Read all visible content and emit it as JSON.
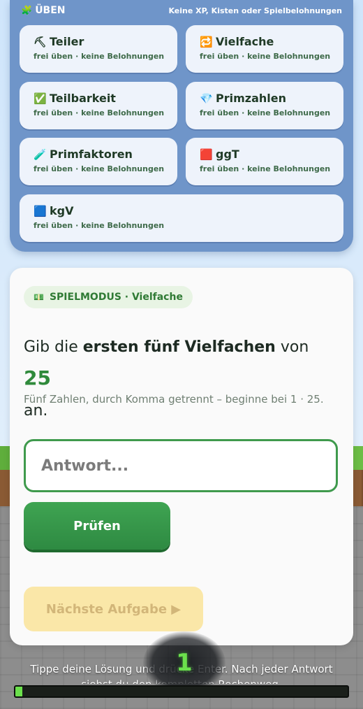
{
  "practice": {
    "title_icon": "puzzle-icon",
    "title": "ÜBEN",
    "note": "Keine XP, Kisten oder Spielbelohnungen",
    "tiles": [
      {
        "icon": "⛏",
        "icon_name": "pickaxe-icon",
        "label": "Teiler",
        "sub": "frei üben · keine Belohnungen"
      },
      {
        "icon": "🔁",
        "icon_name": "repeat-icon",
        "label": "Vielfache",
        "sub": "frei üben · keine Belohnungen"
      },
      {
        "icon": "✅",
        "icon_name": "checkmark-icon",
        "label": "Teilbarkeit",
        "sub": "frei üben · keine Belohnungen"
      },
      {
        "icon": "💎",
        "icon_name": "gem-icon",
        "label": "Primzahlen",
        "sub": "frei üben · keine Belohnungen"
      },
      {
        "icon": "🧪",
        "icon_name": "test-tube-icon",
        "label": "Primfaktoren",
        "sub": "frei üben · keine Belohnungen"
      },
      {
        "icon": "🟥",
        "icon_name": "red-square-icon",
        "label": "ggT",
        "sub": "frei üben · keine Belohnungen"
      },
      {
        "icon": "🟦",
        "icon_name": "blue-square-icon",
        "label": "kgV",
        "sub": "frei üben · keine Belohnungen"
      }
    ]
  },
  "game": {
    "mode_label": "SPIELMODUS · Vielfache",
    "question_pre": "Gib die ",
    "question_bold": "ersten fünf Vielfachen",
    "question_mid": " von ",
    "question_num": "25",
    "question_post": " an.",
    "hint": "Fünf Zahlen, durch Komma getrennt – beginne bei 1 · 25.",
    "answer_value": "",
    "answer_placeholder": "Antwort...",
    "check_label": "Prüfen",
    "next_label": "Nächste Aufgabe ▶"
  },
  "footer": {
    "instruction": "Tippe deine Lösung und drücke Enter. Nach jeder Antwort siehst du den kompletten Rechenweg.",
    "level": "1",
    "xp_progress": 0.02
  },
  "colors": {
    "accent_green": "#2f8a3b",
    "panel_blue": "#6f95c9",
    "next_button": "#fae7a8"
  }
}
